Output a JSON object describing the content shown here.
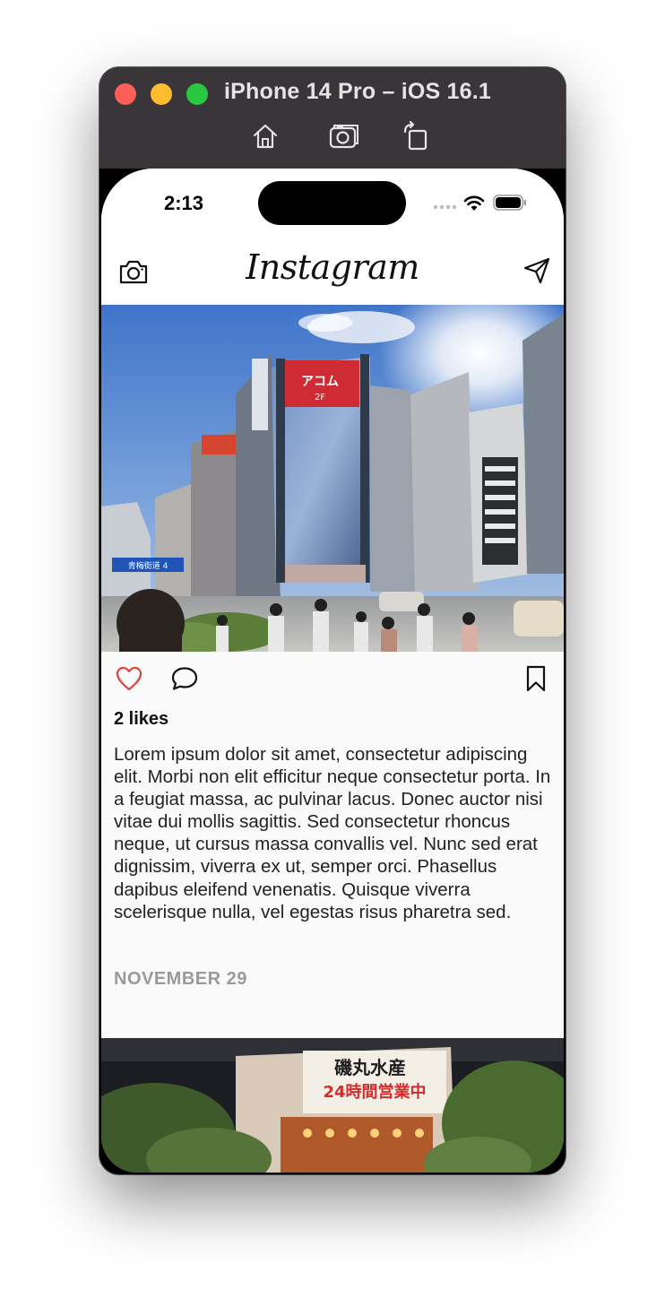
{
  "window": {
    "title": "iPhone 14 Pro – iOS 16.1",
    "toolbar_icons": [
      "home-icon",
      "screenshot-icon",
      "rotate-icon"
    ]
  },
  "status_bar": {
    "time": "2:13",
    "icons": [
      "signal-icon",
      "wifi-icon",
      "battery-icon"
    ]
  },
  "nav": {
    "logo": "Instagram",
    "left_icon": "camera-icon",
    "right_icon": "send-icon"
  },
  "post": {
    "likes": "2 likes",
    "caption": "Lorem ipsum dolor sit amet, consectetur adipiscing elit. Morbi non elit efficitur neque consectetur porta. In a feugiat massa, ac pulvinar lacus. Donec auctor nisi vitae dui mollis sagittis. Sed consectetur rhoncus neque, ut cursus massa convallis vel. Nunc sed erat dignissim, viverra ex ut, semper orci. Phasellus dapibus eleifend venenatis. Quisque viverra scelerisque nulla, vel egestas risus pharetra sed.",
    "date": "NOVEMBER 29",
    "action_icons": [
      "heart-icon",
      "comment-icon",
      "bookmark-icon"
    ],
    "heart_color": "#e0443e",
    "billboard_text": "アコム",
    "billboard_floor": "2F",
    "street_sign": "青梅街道 4"
  },
  "next_post": {
    "sign_main": "磯丸水産",
    "sign_hours": "24時間営業中"
  },
  "colors": {
    "titlebar": "#3a3538",
    "close": "#fe5f57",
    "minimize": "#febc2e",
    "zoom": "#28c840",
    "date_text": "#9a9a9a"
  }
}
